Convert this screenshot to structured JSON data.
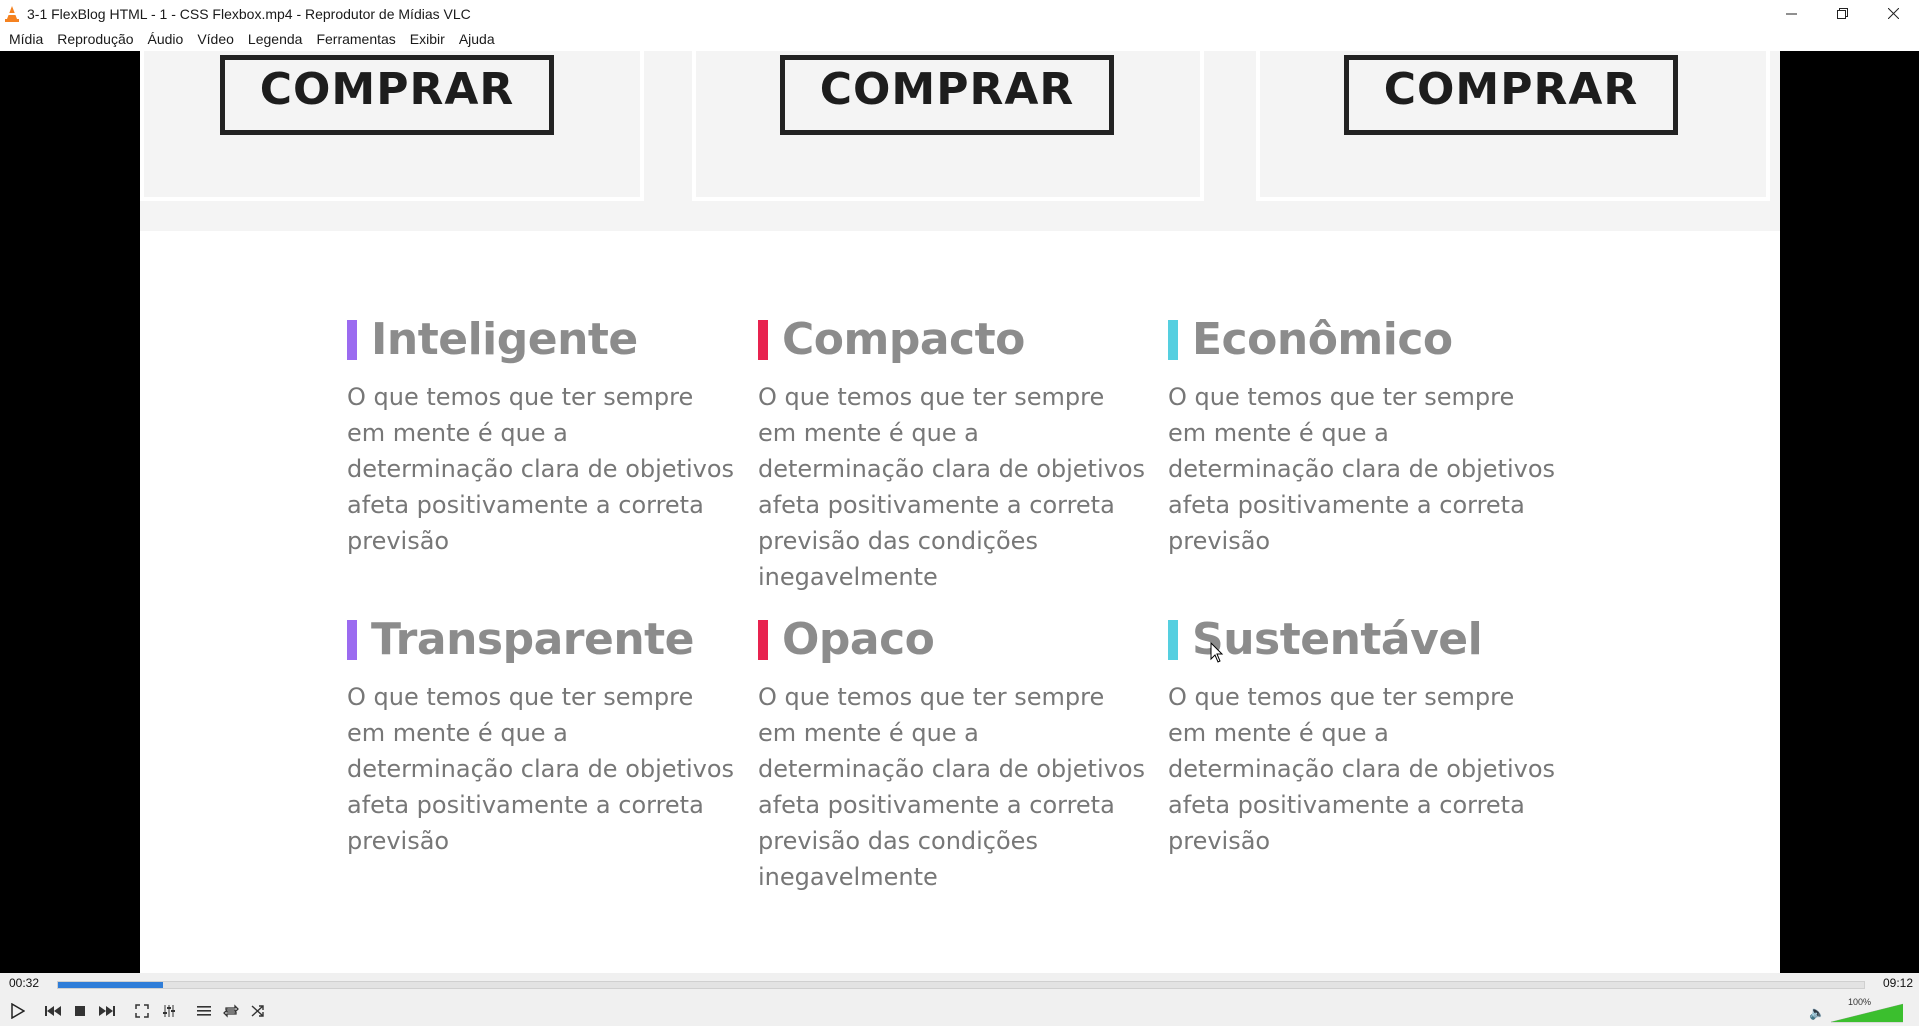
{
  "window": {
    "title": "3-1 FlexBlog HTML - 1 - CSS Flexbox.mp4 - Reprodutor de Mídias VLC",
    "controls": [
      "minimize",
      "maximize",
      "close"
    ]
  },
  "menu": {
    "items": [
      "Mídia",
      "Reprodução",
      "Áudio",
      "Vídeo",
      "Legenda",
      "Ferramentas",
      "Exibir",
      "Ajuda"
    ]
  },
  "video": {
    "buy_buttons": [
      "COMPRAR",
      "COMPRAR",
      "COMPRAR"
    ],
    "features": [
      {
        "title": "Inteligente",
        "text": "O que temos que ter sempre em mente é que a determinação clara de objetivos afeta positivamente a correta previsão",
        "color": "#9b6bf0"
      },
      {
        "title": "Compacto",
        "text": "O que temos que ter sempre em mente é que a determinação clara de objetivos afeta positivamente a correta previsão das condições inegavelmente",
        "color": "#e8234f"
      },
      {
        "title": "Econômico",
        "text": "O que temos que ter sempre em mente é que a determinação clara de objetivos afeta positivamente a correta previsão",
        "color": "#55cfe0"
      },
      {
        "title": "Transparente",
        "text": "O que temos que ter sempre em mente é que a determinação clara de objetivos afeta positivamente a correta previsão",
        "color": "#9b6bf0"
      },
      {
        "title": "Opaco",
        "text": "O que temos que ter sempre em mente é que a determinação clara de objetivos afeta positivamente a correta previsão das condições inegavelmente",
        "color": "#e8234f"
      },
      {
        "title": "Sustentável",
        "text": "O que temos que ter sempre em mente é que a determinação clara de objetivos afeta positivamente a correta previsão",
        "color": "#55cfe0"
      }
    ]
  },
  "player": {
    "elapsed": "00:32",
    "total": "09:12",
    "progress": 0.058,
    "volume_label": "100%",
    "volume_level": 1.0,
    "accent": "#2f7dd8"
  }
}
